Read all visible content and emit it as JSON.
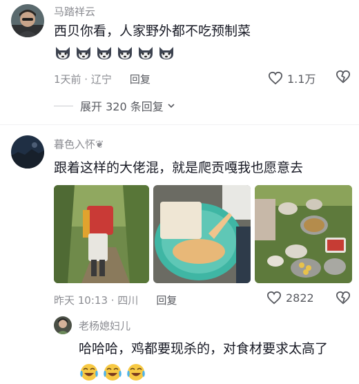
{
  "comment1": {
    "username": "马踏祥云",
    "text": "西贝你看，人家野外都不吃预制菜",
    "emoji_icon": "husky-dog-emoji",
    "emoji_count": 6,
    "time_location": "1天前 · 辽宁",
    "reply_label": "回复",
    "like_count": "1.1万"
  },
  "expand": {
    "label": "展开 320 条回复"
  },
  "comment2": {
    "username": "暮色入怀",
    "username_suffix": "❦",
    "text": "跟着这样的大佬混，就是爬贡嘎我也愿意去",
    "time_location": "昨天 10:13 · 四川",
    "reply_label": "回复",
    "like_count": "2822",
    "photos": [
      "hiker-with-backpack-in-forest",
      "plucked-chicken-in-basin",
      "outdoor-picnic-feast"
    ]
  },
  "reply": {
    "username": "老杨媳妇儿",
    "text": "哈哈哈，鸡都要现杀的，对食材要求太高了",
    "emoji_icon": "laughing-crying-emoji",
    "emoji_count": 3
  },
  "colors": {
    "meta": "#8a8b91",
    "text": "#161823",
    "reply": "#57595f"
  }
}
